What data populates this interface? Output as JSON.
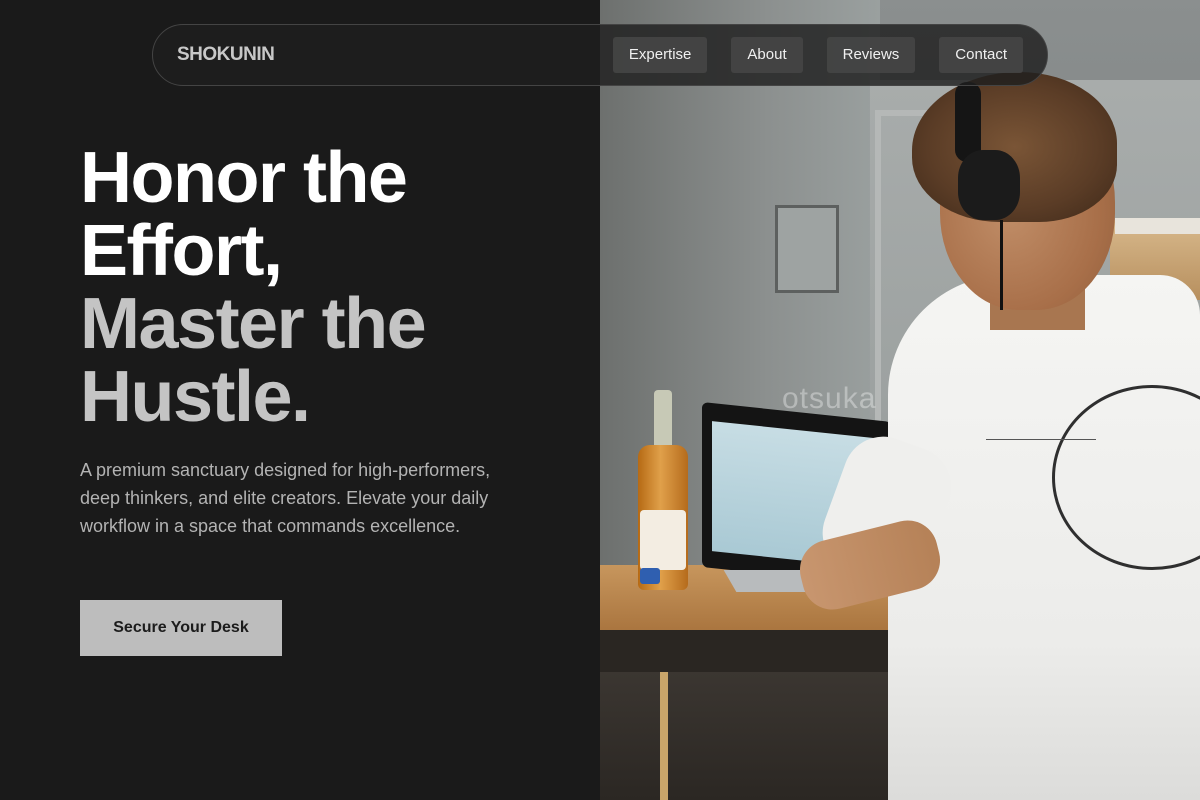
{
  "brand": {
    "name": "SHOKUNIN"
  },
  "nav": {
    "items": [
      {
        "label": "Expertise"
      },
      {
        "label": "About"
      },
      {
        "label": "Reviews"
      },
      {
        "label": "Contact"
      }
    ]
  },
  "hero": {
    "title_line1": "Honor the",
    "title_line2": "Effort,",
    "title_line3": "Master the",
    "title_line4": "Hustle.",
    "body": "A premium sanctuary designed for high-performers, deep thinkers, and elite creators. Elevate your daily workflow in a space that commands excellence.",
    "cta_label": "Secure Your Desk"
  },
  "photo": {
    "watermark": "otsuka"
  },
  "colors": {
    "background": "#1a1a1a",
    "title_primary": "#ffffff",
    "title_secondary": "#c4c4c4",
    "cta_bg": "#bdbdbd",
    "nav_button_bg": "#464646"
  }
}
